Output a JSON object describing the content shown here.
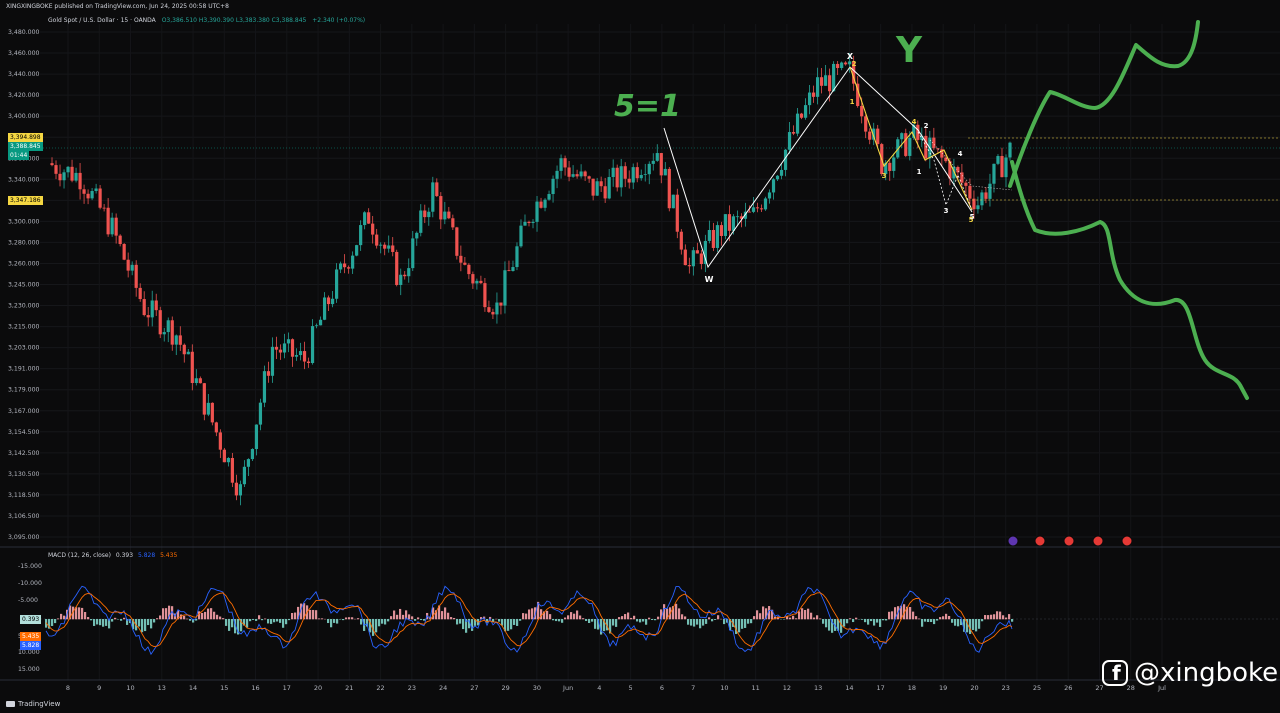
{
  "header": {
    "published": "XINGXINGBOKE published on TradingView.com, Jun 24, 2025 00:58 UTC+8",
    "symbol": "Gold Spot / U.S. Dollar · 15 · OANDA",
    "ohlc": "O3,386.510  H3,390.390  L3,383.380  C3,388.845",
    "change": "+2.340 (+0.07%)"
  },
  "price_axis": {
    "labels": [
      "3,480.000",
      "3,460.000",
      "3,440.000",
      "3,420.000",
      "3,400.000",
      "3,380.000",
      "3,360.000",
      "3,340.000",
      "3,320.000",
      "3,300.000",
      "3,280.000",
      "3,260.000",
      "3,245.000",
      "3,230.000",
      "3,215.000",
      "3,203.000",
      "3,191.000",
      "3,179.000",
      "3,167.000",
      "3,154.500",
      "3,142.500",
      "3,130.500",
      "3,118.500",
      "3,106.500",
      "3,095.000"
    ],
    "tags": {
      "upper": "3,394.898",
      "current": "3,388.845",
      "countdown": "01:44",
      "lower": "3,347.186"
    }
  },
  "macd": {
    "label": "MACD (12, 26, close)",
    "macd_value": "0.393",
    "signal_value": "5.828",
    "hist_value": "5.435",
    "axis_labels": [
      "-15.000",
      "-10.000",
      "-5.000",
      "5.000",
      "10.000",
      "15.000"
    ],
    "tags": {
      "hist": "0.393",
      "signal": "5.435",
      "macd": "5.828"
    }
  },
  "time_axis": {
    "labels": [
      "8",
      "9",
      "10",
      "13",
      "14",
      "15",
      "16",
      "17",
      "20",
      "21",
      "22",
      "23",
      "24",
      "27",
      "29",
      "30",
      "Jun",
      "4",
      "5",
      "6",
      "7",
      "10",
      "11",
      "12",
      "13",
      "14",
      "17",
      "18",
      "19",
      "20",
      "23",
      "25",
      "26",
      "27",
      "28",
      "Jul"
    ]
  },
  "wave_labels": {
    "w": "W",
    "x": "X",
    "y": "Y",
    "handwritten_5_1": "5=1",
    "white_nums": [
      "1",
      "2",
      "3",
      "4",
      "5"
    ],
    "yellow_nums": [
      "1",
      "2",
      "3",
      "4",
      "5"
    ]
  },
  "footer": {
    "brand": "TradingView",
    "watermark": "@xingboke"
  },
  "colors": {
    "background": "#0b0b0c",
    "bull": "#26a69a",
    "bear": "#ef5350",
    "macd_line": "#2962ff",
    "signal_line": "#ff6d00",
    "annotation_green": "#4caf50",
    "annotation_yellow": "#f5d742"
  },
  "chart_data": {
    "type": "line",
    "title": "Gold Spot / U.S. Dollar · 15 · OANDA",
    "xlabel": "",
    "ylabel": "",
    "ylim": [
      3095,
      3480
    ],
    "x": [
      "8",
      "9",
      "10",
      "13",
      "14",
      "15",
      "16",
      "17",
      "20",
      "21",
      "22",
      "23",
      "24",
      "27",
      "29",
      "30",
      "Jun",
      "4",
      "5",
      "6",
      "7",
      "10",
      "11",
      "12",
      "13",
      "14",
      "17",
      "18",
      "19",
      "20",
      "23"
    ],
    "series": [
      {
        "values": [
          3380,
          3370,
          3330,
          3270,
          3250,
          3190,
          3130,
          3240,
          3230,
          3290,
          3340,
          3290,
          3360,
          3300,
          3270,
          3340,
          3380,
          3360,
          3370,
          3390,
          3300,
          3330,
          3340,
          3390,
          3440,
          3450,
          3380,
          3400,
          3380,
          3350,
          3390
        ]
      }
    ],
    "grid": true
  }
}
